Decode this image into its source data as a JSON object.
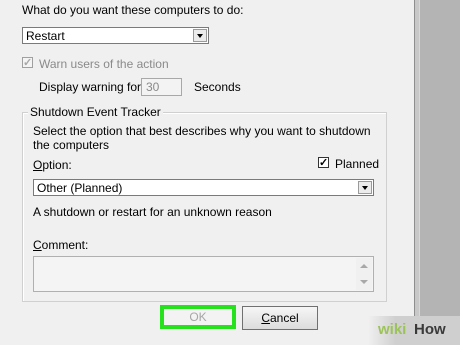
{
  "dialog": {
    "action_prompt": "What do you want these computers to do:",
    "action_select": {
      "value": "Restart"
    },
    "warn_users_label": "Warn users of the action",
    "warn_users_checked": true,
    "display_warning_label": "Display warning for",
    "display_warning_value": "30",
    "display_warning_unit": "Seconds",
    "tracker": {
      "title": "Shutdown Event Tracker",
      "description": "Select the option that best describes why you want to shutdown the computers",
      "option_label": "Option:",
      "planned_label": "Planned",
      "planned_checked": true,
      "option_select": {
        "value": "Other (Planned)"
      },
      "reason_text": "A shutdown or restart for an unknown reason",
      "comment_label": "Comment:"
    },
    "buttons": {
      "ok": "OK",
      "cancel": "Cancel"
    }
  },
  "watermark": {
    "wiki": "wiki",
    "how": "How"
  },
  "colors": {
    "highlight": "#25e21d",
    "dialog_bg": "#f0f0f0"
  }
}
